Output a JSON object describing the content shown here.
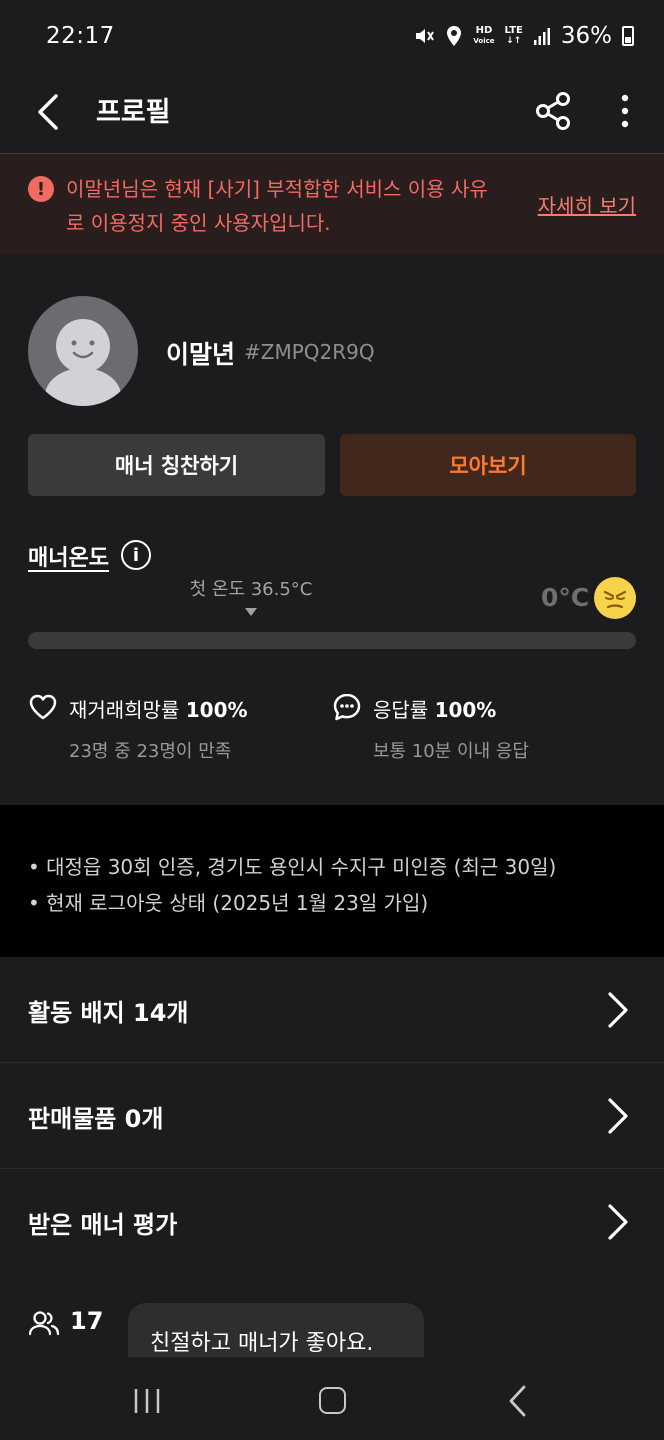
{
  "status_bar": {
    "time": "22:17",
    "hd_top": "HD",
    "hd_bottom": "Voice",
    "lte_label": "LTE",
    "battery": "36%",
    "icons": [
      "mute-icon",
      "location-icon",
      "signal-icon",
      "battery-icon"
    ]
  },
  "app_bar": {
    "title": "프로필",
    "icons": [
      "back-arrow-icon",
      "share-icon",
      "more-vertical-icon"
    ]
  },
  "warning": {
    "text": "이말년님은 현재 [사기] 부적합한 서비스 이용 사유로 이용정지 중인 사용자입니다.",
    "link": "자세히 보기",
    "color": "#f26b60"
  },
  "profile": {
    "nickname": "이말년",
    "code": "#ZMPQ2R9Q"
  },
  "buttons": {
    "praise": "매너 칭찬하기",
    "collect": "모아보기",
    "collect_color": "#ff7a2f"
  },
  "manner": {
    "label": "매너온도",
    "first_temp": "첫 온도 36.5°C",
    "value_label": "0°C",
    "value": 0
  },
  "stats": {
    "rebuy_label": "재거래희망률",
    "rebuy_value": "100%",
    "rebuy_sub": "23명 중 23명이 만족",
    "response_label": "응답률",
    "response_value": "100%",
    "response_sub": "보통 10분 이내 응답"
  },
  "info": {
    "line1": "• 대정읍 30회 인증, 경기도 용인시 수지구 미인증 (최근 30일)",
    "line2": "• 현재 로그아웃 상태 (2025년 1월 23일 가입)"
  },
  "rows": {
    "badges": "활동 배지 14개",
    "items": "판매물품 0개",
    "reviews": "받은 매너 평가"
  },
  "manner_review": {
    "count": "17",
    "text": "친절하고 매너가 좋아요."
  }
}
